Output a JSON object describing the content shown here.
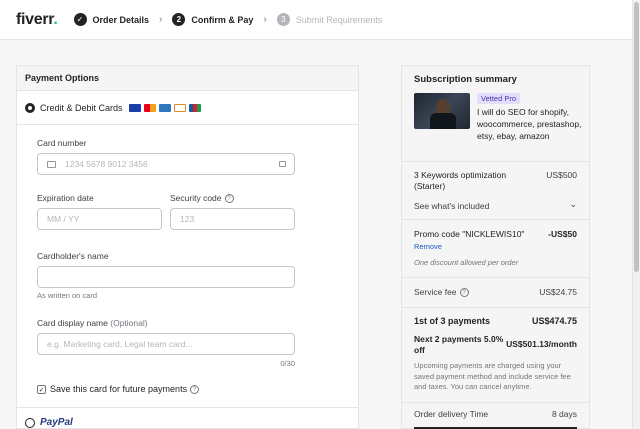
{
  "header": {
    "logo": "fiverr",
    "logo_dot": ".",
    "steps": [
      {
        "num": "✓",
        "label": "Order Details"
      },
      {
        "num": "2",
        "label": "Confirm & Pay"
      },
      {
        "num": "3",
        "label": "Submit Requirements"
      }
    ]
  },
  "payment": {
    "title": "Payment Options",
    "card_option": "Credit & Debit Cards",
    "card_number_label": "Card number",
    "card_number_placeholder": "1234 5678 9012 3456",
    "expiration_label": "Expiration date",
    "expiration_placeholder": "MM / YY",
    "security_label": "Security code",
    "security_placeholder": "123",
    "cardholder_label": "Cardholder's name",
    "cardholder_hint": "As written on card",
    "display_name_label": "Card display name",
    "display_name_optional": "(Optional)",
    "display_name_placeholder": "e.g. Marketing card, Legal team card...",
    "display_name_counter": "0/30",
    "save_card_label": "Save this card for future payments",
    "paypal_label": "PayPal"
  },
  "summary": {
    "title": "Subscription summary",
    "badge": "Vetted Pro",
    "gig_title": "I will do SEO for shopify, woocommerce, prestashop, etsy, ebay, amazon",
    "package_label": "3 Keywords optimization (Starter)",
    "package_price": "US$500",
    "included_label": "See what's included",
    "promo_label": "Promo code \"NICKLEWIS10\"",
    "promo_value": "-US$50",
    "promo_remove": "Remove",
    "promo_note": "One discount allowed per order",
    "service_fee_label": "Service fee",
    "service_fee_value": "US$24.75",
    "payment_label": "1st of 3 payments",
    "payment_value": "US$474.75",
    "next_label": "Next 2 payments 5.0% off",
    "next_value": "US$501.13/month",
    "note": "Upcoming payments are charged using your saved payment method and include service fee and taxes. You can cancel anytime.",
    "delivery_label": "Order delivery Time",
    "delivery_value": "8 days"
  },
  "colors": {
    "brand": "#1dbf73",
    "vetted_bg": "#e2ddfa",
    "link": "#1d59c2"
  }
}
